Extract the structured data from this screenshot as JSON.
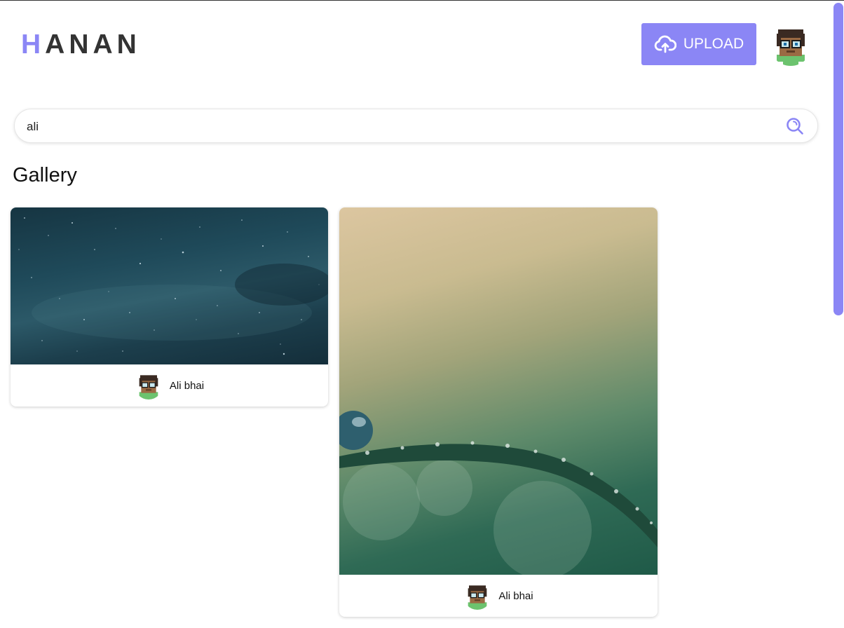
{
  "header": {
    "logo_first": "H",
    "logo_rest": "ANAN",
    "upload_label": "UPLOAD",
    "upload_icon": "cloud-upload-icon"
  },
  "search": {
    "value": "ali",
    "icon": "search-icon"
  },
  "gallery": {
    "title": "Gallery",
    "items": [
      {
        "author": "Ali bhai",
        "image": "starry-night-sky"
      },
      {
        "author": "Ali bhai",
        "image": "water-drops-on-grass-blade"
      }
    ]
  },
  "colors": {
    "accent": "#8b86f5",
    "logo": "#333333"
  }
}
